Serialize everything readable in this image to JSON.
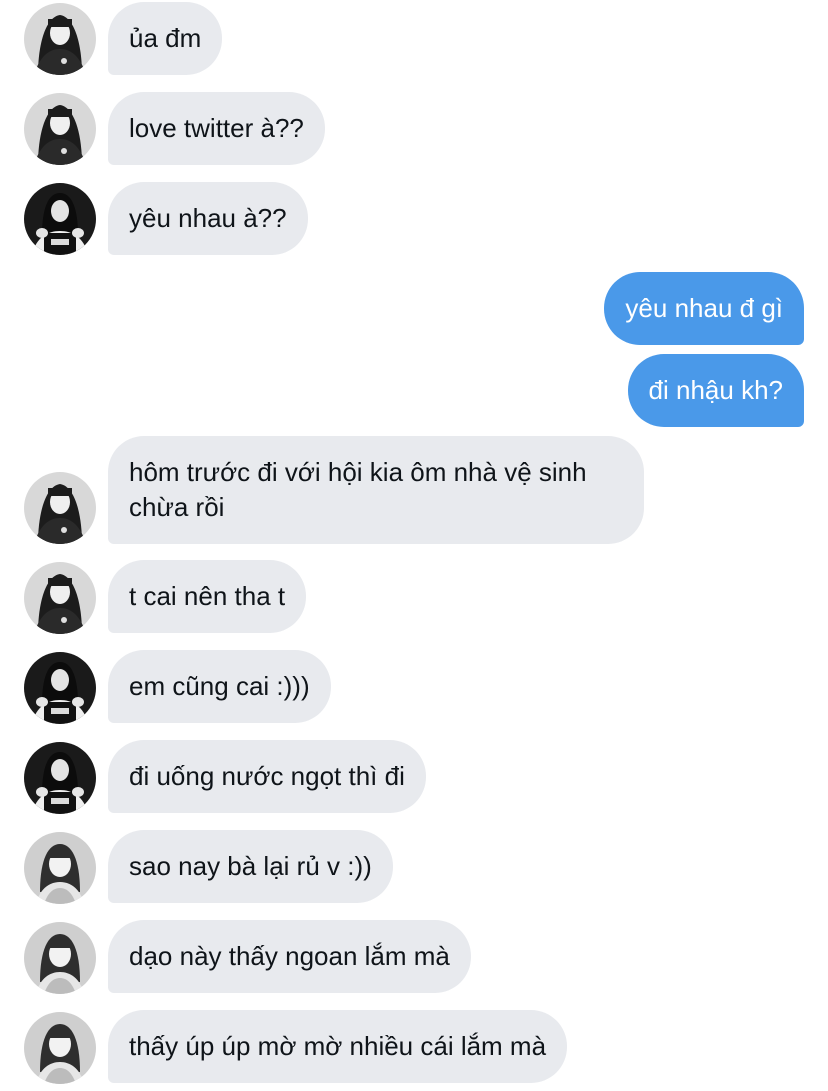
{
  "conversation": {
    "messages": [
      {
        "direction": "in",
        "avatar": "avatar-a",
        "text": "ủa đm"
      },
      {
        "direction": "in",
        "avatar": "avatar-a",
        "text": "love twitter à??"
      },
      {
        "direction": "in",
        "avatar": "avatar-b",
        "text": "yêu nhau à??"
      },
      {
        "direction": "out",
        "text": "yêu nhau đ gì"
      },
      {
        "direction": "out",
        "text": "đi nhậu kh?"
      },
      {
        "direction": "in",
        "avatar": "avatar-a",
        "text": "hôm trước đi với hội kia ôm nhà vệ sinh chừa rồi"
      },
      {
        "direction": "in",
        "avatar": "avatar-a",
        "text": "t cai nên tha t"
      },
      {
        "direction": "in",
        "avatar": "avatar-b",
        "text": "em cũng cai :)))"
      },
      {
        "direction": "in",
        "avatar": "avatar-b",
        "text": "đi uống nước ngọt thì đi"
      },
      {
        "direction": "in",
        "avatar": "avatar-c",
        "text": "sao nay bà lại rủ v :))"
      },
      {
        "direction": "in",
        "avatar": "avatar-c",
        "text": "dạo này thấy ngoan lắm mà"
      },
      {
        "direction": "in",
        "avatar": "avatar-c",
        "text": "thấy úp úp mờ mờ nhiều cái lắm mà"
      }
    ]
  },
  "colors": {
    "incoming_bubble": "#e8eaee",
    "outgoing_bubble": "#4a99e9",
    "incoming_text": "#0f1419",
    "outgoing_text": "#ffffff"
  }
}
